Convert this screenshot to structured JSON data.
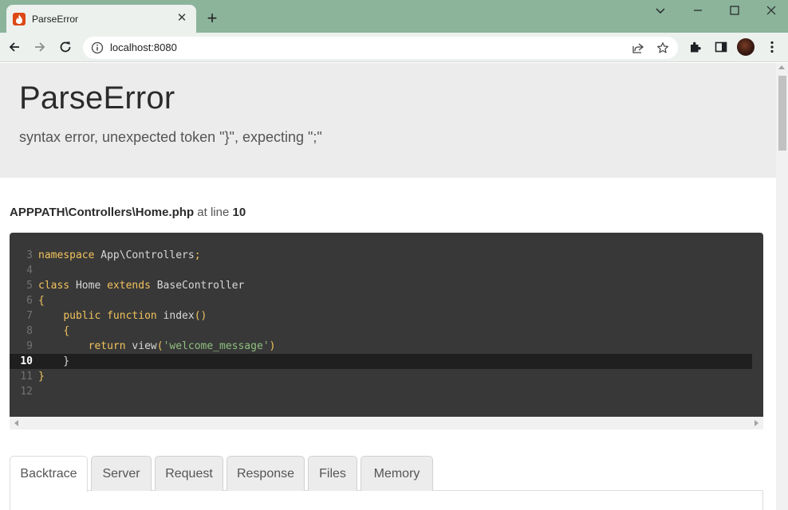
{
  "browser": {
    "tab_title": "ParseError",
    "tab_close": "✕",
    "new_tab": "+",
    "url": "localhost:8080"
  },
  "page": {
    "error_title": "ParseError",
    "error_message": "syntax error, unexpected token \"}\", expecting \";\"",
    "file_path": "APPPATH\\Controllers\\Home.php",
    "at_line_text": "at line",
    "line_number": "10"
  },
  "code": {
    "highlighted_line": 10,
    "lines": [
      {
        "n": "3",
        "parts": [
          [
            "kw",
            "namespace"
          ],
          [
            "plain",
            " App\\Controllers"
          ],
          [
            "kw",
            ";"
          ]
        ]
      },
      {
        "n": "4",
        "parts": []
      },
      {
        "n": "5",
        "parts": [
          [
            "kw",
            "class"
          ],
          [
            "plain",
            " Home "
          ],
          [
            "kw",
            "extends"
          ],
          [
            "plain",
            " BaseController"
          ]
        ]
      },
      {
        "n": "6",
        "parts": [
          [
            "kw",
            "{"
          ]
        ]
      },
      {
        "n": "7",
        "parts": [
          [
            "plain",
            "    "
          ],
          [
            "kw",
            "public"
          ],
          [
            "plain",
            " "
          ],
          [
            "kw",
            "function"
          ],
          [
            "plain",
            " index"
          ],
          [
            "kw",
            "()"
          ]
        ]
      },
      {
        "n": "8",
        "parts": [
          [
            "plain",
            "    "
          ],
          [
            "kw",
            "{"
          ]
        ]
      },
      {
        "n": "9",
        "parts": [
          [
            "plain",
            "        "
          ],
          [
            "kw",
            "return"
          ],
          [
            "plain",
            " view"
          ],
          [
            "kw",
            "("
          ],
          [
            "str",
            "'welcome_message'"
          ],
          [
            "kw",
            ")"
          ]
        ]
      },
      {
        "n": "10",
        "parts": [
          [
            "plain",
            "    }"
          ]
        ]
      },
      {
        "n": "11",
        "parts": [
          [
            "kw",
            "}"
          ]
        ]
      },
      {
        "n": "12",
        "parts": []
      }
    ]
  },
  "tabs": [
    {
      "label": "Backtrace",
      "active": true
    },
    {
      "label": "Server",
      "active": false
    },
    {
      "label": "Request",
      "active": false
    },
    {
      "label": "Response",
      "active": false
    },
    {
      "label": "Files",
      "active": false
    },
    {
      "label": "Memory",
      "active": false
    }
  ],
  "colors": {
    "titlebar": "#8bb49b",
    "toolbar": "#ecf1ee",
    "header_bg": "#ececec",
    "code_bg": "#383838",
    "keyword": "#f2c35c",
    "string": "#8fbf7f"
  }
}
